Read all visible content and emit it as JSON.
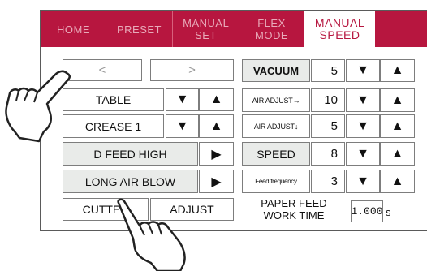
{
  "tabs": [
    {
      "label": "HOME",
      "active": false
    },
    {
      "label": "PRESET",
      "active": false
    },
    {
      "label": "MANUAL SET",
      "active": false
    },
    {
      "label": "FLEX MODE",
      "active": false
    },
    {
      "label": "MANUAL SPEED",
      "active": true
    }
  ],
  "left": {
    "prev_label": "<",
    "next_label": ">",
    "table_label": "TABLE",
    "crease_label": "CREASE 1",
    "dfeed_label": "D FEED HIGH",
    "longair_label": "LONG AIR BLOW",
    "cutter_label": "CUTTER",
    "adjust_label": "ADJUST",
    "play_glyph": "▶",
    "down_glyph": "▼",
    "up_glyph": "▲"
  },
  "right": {
    "rows": [
      {
        "label": "VACUUM",
        "value": "5"
      },
      {
        "label": "AIR ADJUST→",
        "value": "10"
      },
      {
        "label": "AIR ADJUST↓",
        "value": "5"
      },
      {
        "label": "SPEED",
        "value": "8"
      },
      {
        "label": "Feed frequency",
        "value": "3"
      }
    ],
    "paper_feed_line1": "PAPER FEED",
    "paper_feed_line2": "WORK TIME",
    "paper_feed_value": "1.000",
    "paper_feed_unit": "s"
  },
  "colors": {
    "tab_bar": "#b7163f",
    "tab_text_inactive": "#e8aab9",
    "border": "#7d7d7d",
    "gray_button": "#e9ebe9"
  },
  "icons": {
    "pointer": "pointing-hand-icon"
  }
}
